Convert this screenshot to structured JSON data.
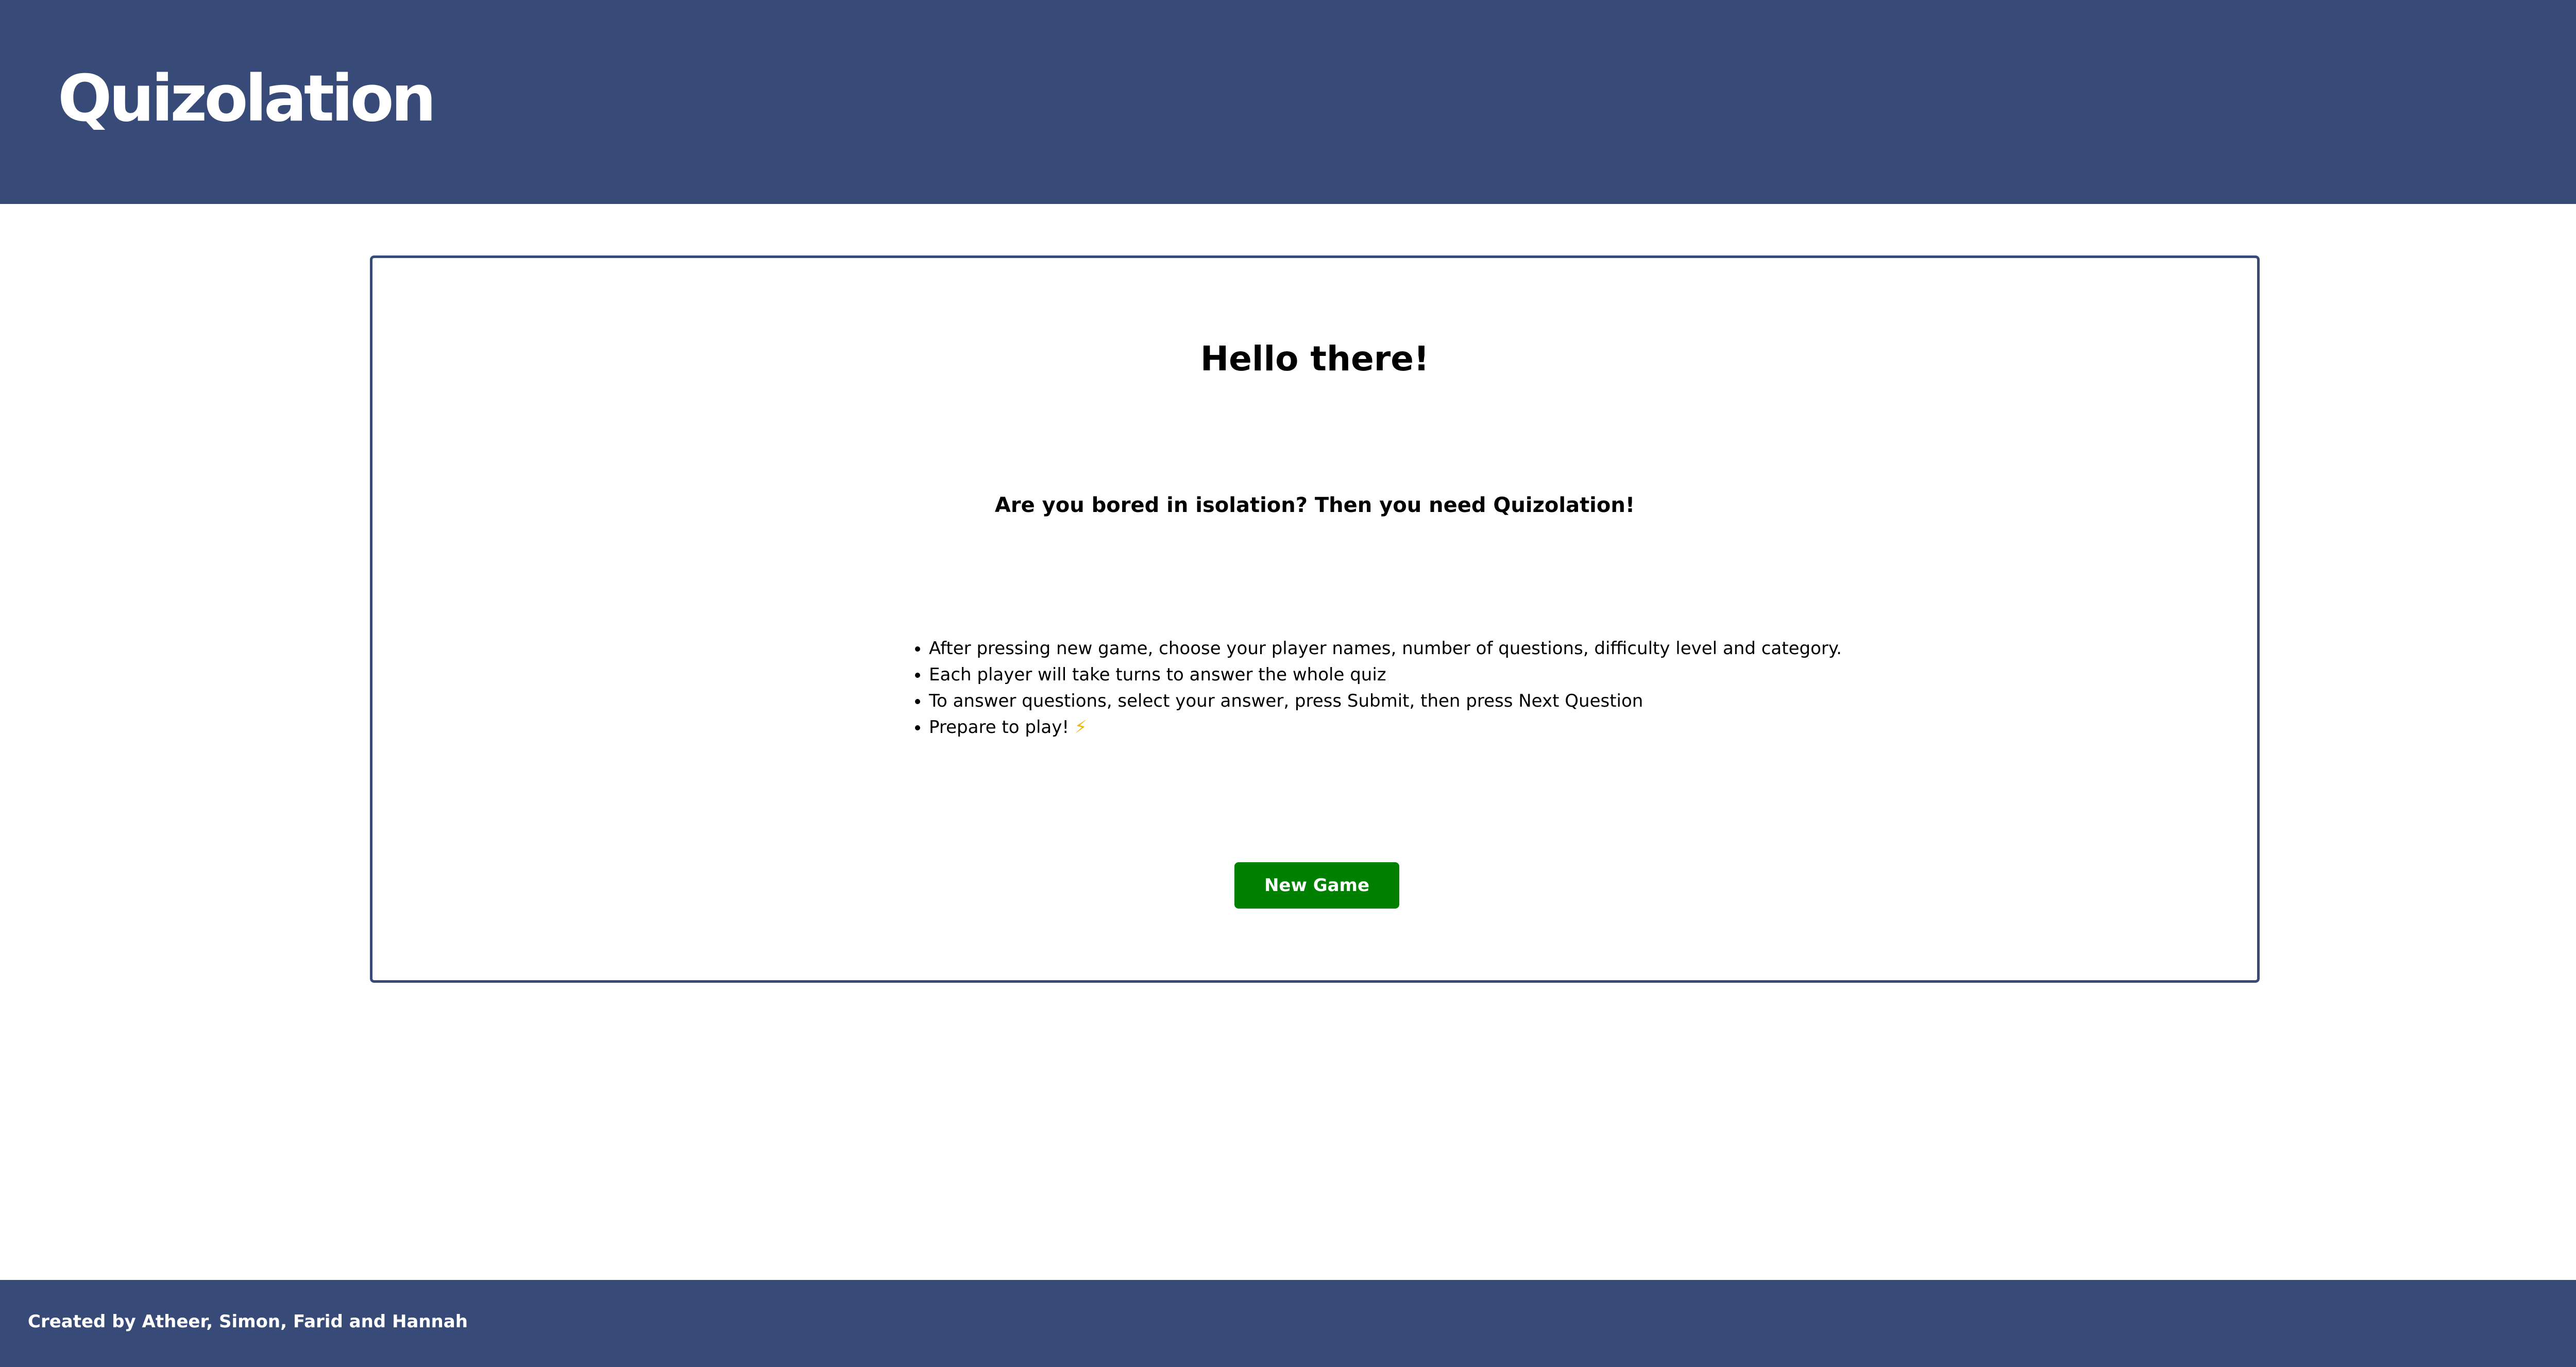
{
  "header": {
    "logo_text": "Quizolation"
  },
  "main": {
    "greeting": "Hello there!",
    "tagline": "Are you bored in isolation? Then you need Quizolation!",
    "instructions": [
      "After pressing new game, choose your player names, number of questions, difficulty level and category.",
      "Each player will take turns to answer the whole quiz",
      "To answer questions, select your answer, press Submit, then press Next Question",
      "Prepare to play!"
    ],
    "instruction_icon": "⚡",
    "new_game_label": "New Game"
  },
  "footer": {
    "credits": "Created by Atheer, Simon, Farid and Hannah"
  },
  "colors": {
    "brand_navy": "#384b78",
    "button_green": "#008000",
    "lightning": "#f0b400"
  },
  "icons": {
    "instruction_icon_name": "lightning-icon"
  }
}
